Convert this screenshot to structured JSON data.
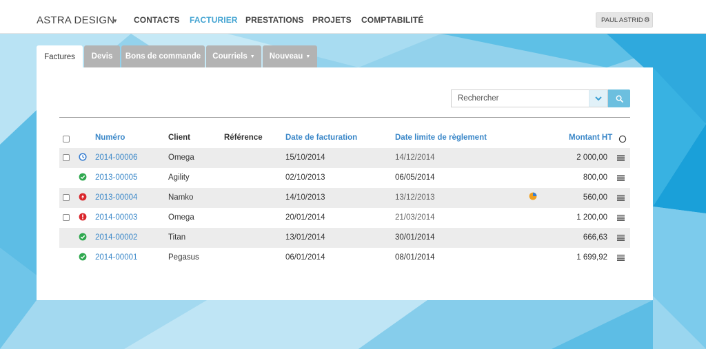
{
  "header": {
    "brand": "ASTRA DESIGN",
    "nav": [
      "CONTACTS",
      "FACTURIER",
      "PRESTATIONS",
      "PROJETS",
      "COMPTABILITÉ"
    ],
    "active_nav": "FACTURIER",
    "user": "PAUL ASTRID"
  },
  "tabs": [
    {
      "label": "Factures",
      "active": true
    },
    {
      "label": "Devis",
      "active": false
    },
    {
      "label": "Bons de commande",
      "active": false
    },
    {
      "label": "Courriels",
      "active": false,
      "dropdown": true
    },
    {
      "label": "Nouveau",
      "active": false,
      "dropdown": true
    }
  ],
  "search": {
    "placeholder": "Rechercher"
  },
  "table": {
    "columns": [
      "Numéro",
      "Client",
      "Référence",
      "Date de facturation",
      "Date limite de règlement",
      "Montant HT"
    ],
    "rows": [
      {
        "numero": "2014-00006",
        "client": "Omega",
        "reference": "",
        "date_facturation": "15/10/2014",
        "date_limite": "14/12/2014",
        "montant": "2 000,00",
        "status": "pending-clock",
        "checkbox": true,
        "partial": false
      },
      {
        "numero": "2013-00005",
        "client": "Agility",
        "reference": "",
        "date_facturation": "02/10/2013",
        "date_limite": "06/05/2014",
        "montant": "800,00",
        "status": "paid-check",
        "checkbox": false,
        "partial": false
      },
      {
        "numero": "2013-00004",
        "client": "Namko",
        "reference": "",
        "date_facturation": "14/10/2013",
        "date_limite": "13/12/2013",
        "montant": "560,00",
        "status": "overdue-flame",
        "checkbox": true,
        "partial": true
      },
      {
        "numero": "2014-00003",
        "client": "Omega",
        "reference": "",
        "date_facturation": "20/01/2014",
        "date_limite": "21/03/2014",
        "montant": "1 200,00",
        "status": "alert-exclamation",
        "checkbox": true,
        "partial": false
      },
      {
        "numero": "2014-00002",
        "client": "Titan",
        "reference": "",
        "date_facturation": "13/01/2014",
        "date_limite": "30/01/2014",
        "montant": "666,63",
        "status": "paid-check",
        "checkbox": false,
        "partial": false
      },
      {
        "numero": "2014-00001",
        "client": "Pegasus",
        "reference": "",
        "date_facturation": "06/01/2014",
        "date_limite": "08/01/2014",
        "montant": "1 699,92",
        "status": "paid-check",
        "checkbox": false,
        "partial": false
      }
    ]
  },
  "colors": {
    "accent": "#44a4d2",
    "link": "#3a87c8",
    "paid": "#2fa84f",
    "overdue": "#d9262b",
    "pending": "#3a7fd0",
    "partial": "#f0a020"
  }
}
